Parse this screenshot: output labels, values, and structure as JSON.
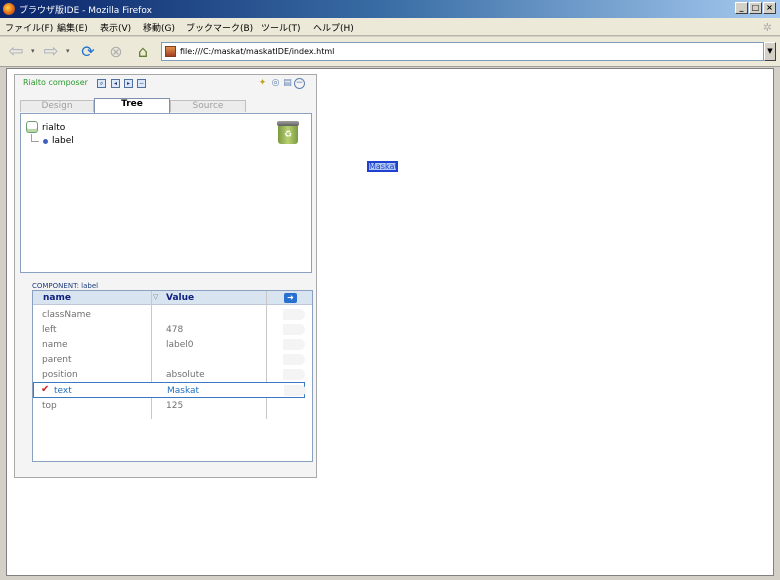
{
  "window": {
    "title": "ブラウザ版IDE - Mozilla Firefox",
    "buttons": [
      "_",
      "□",
      "×"
    ]
  },
  "menu": [
    "ファイル(F)",
    "編集(E)",
    "表示(V)",
    "移動(G)",
    "ブックマーク(B)",
    "ツール(T)",
    "ヘルプ(H)"
  ],
  "toolbar": {
    "url": "file:///C:/maskat/maskatIDE/index.html"
  },
  "panel": {
    "title": "Rialto composer",
    "tabs": [
      "Design",
      "Tree",
      "Source"
    ],
    "tree": {
      "root": "rialto",
      "child": "label"
    },
    "component_label": "COMPONENT: label",
    "props": {
      "col_name": "name",
      "col_value": "Value",
      "rows": [
        {
          "name": "className",
          "value": ""
        },
        {
          "name": "left",
          "value": "478"
        },
        {
          "name": "name",
          "value": "label0"
        },
        {
          "name": "parent",
          "value": ""
        },
        {
          "name": "position",
          "value": "absolute"
        },
        {
          "name": "text",
          "value": "Maskat",
          "selected": true
        },
        {
          "name": "top",
          "value": "125"
        }
      ]
    }
  },
  "canvas": {
    "label_text": "Maskat"
  },
  "colors": {
    "accent": "#2040d0",
    "selected_text": "#1f6fc0",
    "panel_title": "#2a9a2a"
  }
}
